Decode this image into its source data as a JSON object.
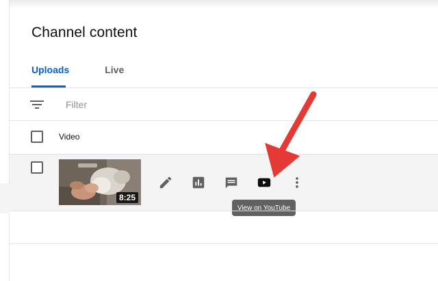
{
  "page": {
    "title": "Channel content"
  },
  "tabs": [
    {
      "label": "Uploads",
      "active": true
    },
    {
      "label": "Live",
      "active": false
    }
  ],
  "filter": {
    "placeholder": "Filter",
    "value": ""
  },
  "table": {
    "columns": {
      "video": "Video"
    },
    "rows": [
      {
        "duration": "8:25"
      }
    ]
  },
  "actions": {
    "details": "pencil-icon",
    "analytics": "analytics-icon",
    "comments": "comment-icon",
    "view_on_youtube": "youtube-play-icon",
    "options": "more-vert-icon"
  },
  "tooltip": {
    "text": "View on YouTube"
  },
  "colors": {
    "accent": "#065fd4",
    "icon": "#606060",
    "annotation_arrow": "#e53935",
    "tooltip_bg": "#616161",
    "row_hover": "#f4f4f4"
  }
}
